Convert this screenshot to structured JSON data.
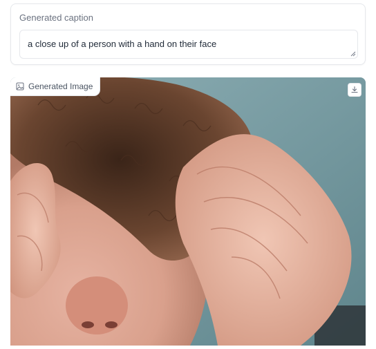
{
  "caption": {
    "label": "Generated caption",
    "value": "a close up of a person with a hand on their face"
  },
  "image": {
    "label": "Generated Image",
    "label_icon": "image-icon",
    "download_icon": "download-icon"
  },
  "colors": {
    "card_border": "#e5e7eb",
    "label_text": "#6b7280",
    "body_text": "#1f2937",
    "photo_background": "#7a9ea5",
    "skin": "#d9a08c",
    "hair": "#5a3a28"
  }
}
